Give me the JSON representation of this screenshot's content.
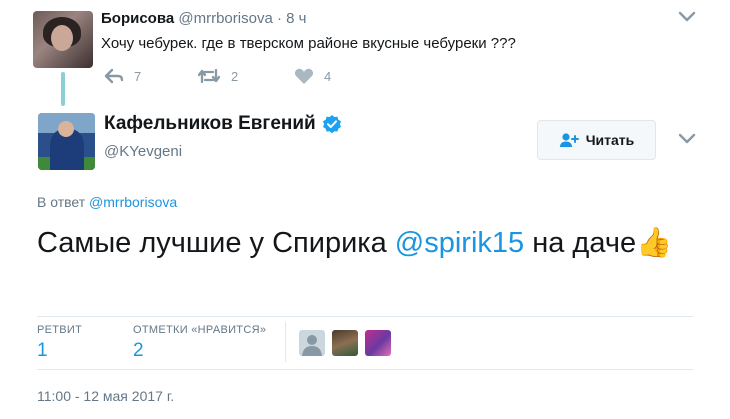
{
  "parent_tweet": {
    "name": "Борисова",
    "handle": "@mrrborisova",
    "time": "8 ч",
    "text": "Хочу чебурек. где в тверском районе вкусные чебуреки ???",
    "reply_count": "7",
    "retweet_count": "2",
    "like_count": "4",
    "icons": [
      "reply-icon",
      "retweet-icon",
      "heart-icon",
      "chevron-down-icon"
    ]
  },
  "main_tweet": {
    "name": "Кафельников Евгений",
    "handle": "@KYevgeni",
    "follow_label": "Читать",
    "reply_prefix": "В ответ",
    "reply_to": "@mrrborisova",
    "text_before": "Самые лучшие у Спирика ",
    "mention": "@spirik15",
    "text_after": " на даче",
    "emoji": "👍",
    "stats": {
      "retweets_label": "РЕТВИТ",
      "retweets_value": "1",
      "likes_label": "ОТМЕТКИ «НРАВИТСЯ»",
      "likes_value": "2"
    },
    "timestamp": "11:00 - 12 мая 2017 г.",
    "icons": [
      "verified-icon",
      "add-user-icon",
      "chevron-down-icon"
    ]
  },
  "colors": {
    "link": "#1b95e0",
    "muted": "#657786",
    "thread_line": "#8ecfd6",
    "icon_gray": "#8899a6"
  }
}
